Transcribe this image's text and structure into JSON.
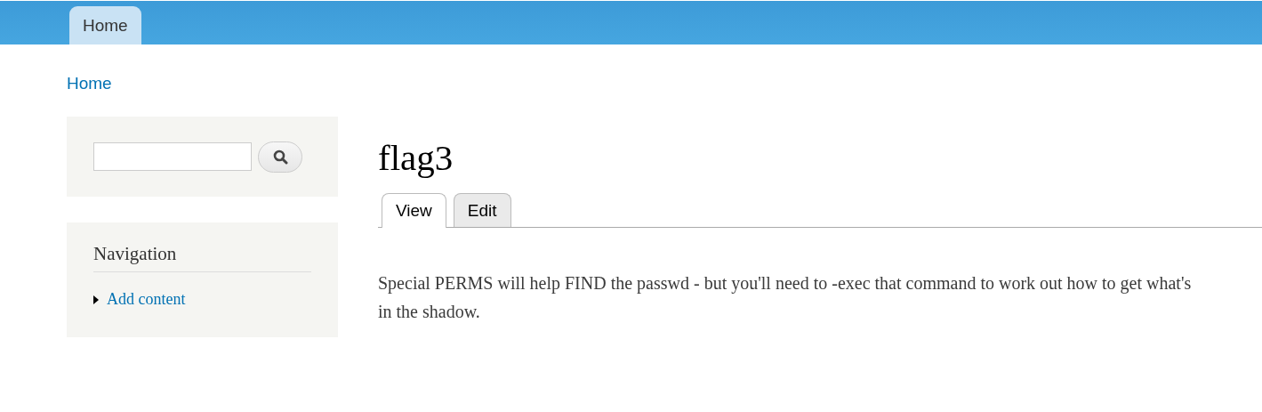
{
  "header": {
    "tabs": [
      {
        "label": "Home",
        "selected": true
      }
    ]
  },
  "breadcrumb": [
    "Home"
  ],
  "navigation": {
    "title": "Navigation",
    "items": [
      {
        "label": "Add content",
        "expanded": false
      }
    ]
  },
  "page": {
    "title": "flag3",
    "tabs": [
      {
        "label": "View",
        "selected": true
      },
      {
        "label": "Edit",
        "selected": false
      }
    ],
    "body_lines": [
      "Special PERMS will help FIND the passwd - but you'll need to -exec that command to work out how to get what's",
      "in the shadow."
    ]
  }
}
